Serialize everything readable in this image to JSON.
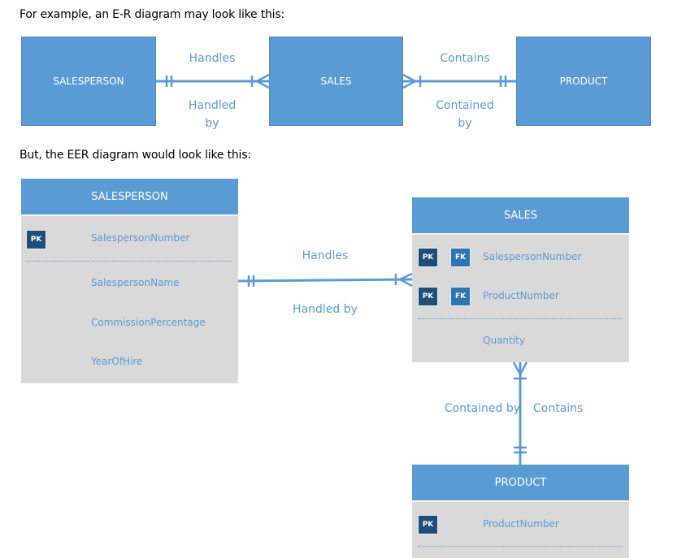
{
  "document": {
    "intro_text": "For example, an E-R diagram may look like this:",
    "eer_intro_text": "But, the EER diagram would look like this:"
  },
  "er_diagram": {
    "entities": {
      "salesperson": "SALESPERSON",
      "sales": "SALES",
      "product": "PRODUCT"
    },
    "relationships": {
      "handles": {
        "top_label": "Handles",
        "bottom_label_line1": "Handled",
        "bottom_label_line2": "by"
      },
      "contains": {
        "top_label": "Contains",
        "bottom_label_line1": "Contained",
        "bottom_label_line2": "by"
      }
    }
  },
  "eer_diagram": {
    "salesperson": {
      "title": "SALESPERSON",
      "key_attributes": [
        {
          "keys": [
            "PK"
          ],
          "name": "SalespersonNumber"
        }
      ],
      "attributes": [
        "SalespersonName",
        "CommissionPercentage",
        "YearOfHire"
      ]
    },
    "sales": {
      "title": "SALES",
      "key_attributes": [
        {
          "keys": [
            "PK",
            "FK"
          ],
          "name": "SalespersonNumber"
        },
        {
          "keys": [
            "PK",
            "FK"
          ],
          "name": "ProductNumber"
        }
      ],
      "attributes": [
        "Quantity"
      ]
    },
    "product": {
      "title": "PRODUCT",
      "key_attributes": [
        {
          "keys": [
            "PK"
          ],
          "name": "ProductNumber"
        }
      ],
      "attributes": []
    },
    "relationships": {
      "handles": {
        "top_label": "Handles",
        "bottom_label": "Handled by"
      },
      "contains": {
        "left_label": "Contained by",
        "right_label": "Contains"
      }
    }
  },
  "colors": {
    "entity_blue": "#5b9bd5",
    "pk_badge": "#1f4e79",
    "fk_badge": "#2e75b6",
    "table_body": "#d9d9d9"
  }
}
